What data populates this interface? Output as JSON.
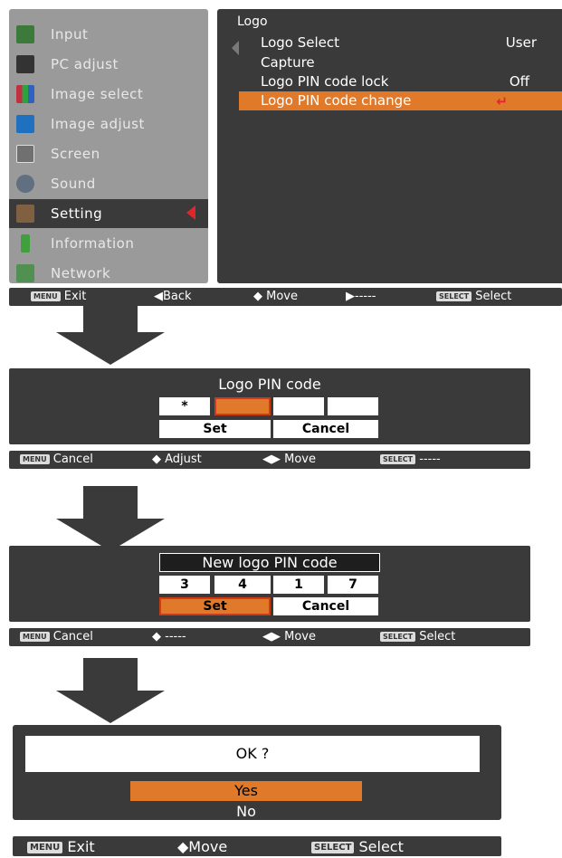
{
  "main_menu": {
    "items": [
      {
        "label": "Input",
        "icon": "input-icon",
        "color": "#3c7a3c"
      },
      {
        "label": "PC adjust",
        "icon": "pc-adjust-icon",
        "color": "#333333"
      },
      {
        "label": "Image select",
        "icon": "image-select-icon",
        "color": "#b03040"
      },
      {
        "label": "Image adjust",
        "icon": "image-adjust-icon",
        "color": "#2070c0"
      },
      {
        "label": "Screen",
        "icon": "screen-icon",
        "color": "#707070"
      },
      {
        "label": "Sound",
        "icon": "sound-icon",
        "color": "#607080"
      },
      {
        "label": "Setting",
        "icon": "setting-icon",
        "color": "#806040"
      },
      {
        "label": "Information",
        "icon": "information-icon",
        "color": "#40a040"
      },
      {
        "label": "Network",
        "icon": "network-icon",
        "color": "#509050"
      }
    ],
    "active_index": 6
  },
  "submenu": {
    "title": "Logo",
    "rows": [
      {
        "label": "Logo Select",
        "value": "User"
      },
      {
        "label": "Capture",
        "value": ""
      },
      {
        "label": "Logo PIN code lock",
        "value": "Off"
      },
      {
        "label": "Logo PIN code change",
        "value": ""
      }
    ],
    "enter_symbol": "↵"
  },
  "help1": {
    "exit": "Exit",
    "back": "◀Back",
    "move": "◆ Move",
    "next": "▶-----",
    "select": "Select",
    "menu_key": "MENU",
    "select_key": "SELECT"
  },
  "pin_dialog": {
    "title": "Logo PIN code",
    "digits": [
      "*",
      "",
      "",
      ""
    ],
    "set": "Set",
    "cancel": "Cancel"
  },
  "help2": {
    "cancel": "Cancel",
    "adjust": "◆ Adjust",
    "move": "◀▶ Move",
    "select": "-----",
    "menu_key": "MENU",
    "select_key": "SELECT"
  },
  "new_pin_dialog": {
    "title": "New logo PIN code",
    "digits": [
      "3",
      "4",
      "1",
      "7"
    ],
    "set": "Set",
    "cancel": "Cancel"
  },
  "help3": {
    "cancel": "Cancel",
    "adjust": "◆ -----",
    "move": "◀▶ Move",
    "select": "Select",
    "menu_key": "MENU",
    "select_key": "SELECT"
  },
  "confirm_dialog": {
    "question": "OK ?",
    "yes": "Yes",
    "no": "No"
  },
  "help4": {
    "exit": "Exit",
    "move": "◆Move",
    "select": "Select",
    "menu_key": "MENU",
    "select_key": "SELECT"
  },
  "colors": {
    "accent": "#e07a2a",
    "panel": "#3a3a3a",
    "menu_bg": "#9a9a9a"
  }
}
